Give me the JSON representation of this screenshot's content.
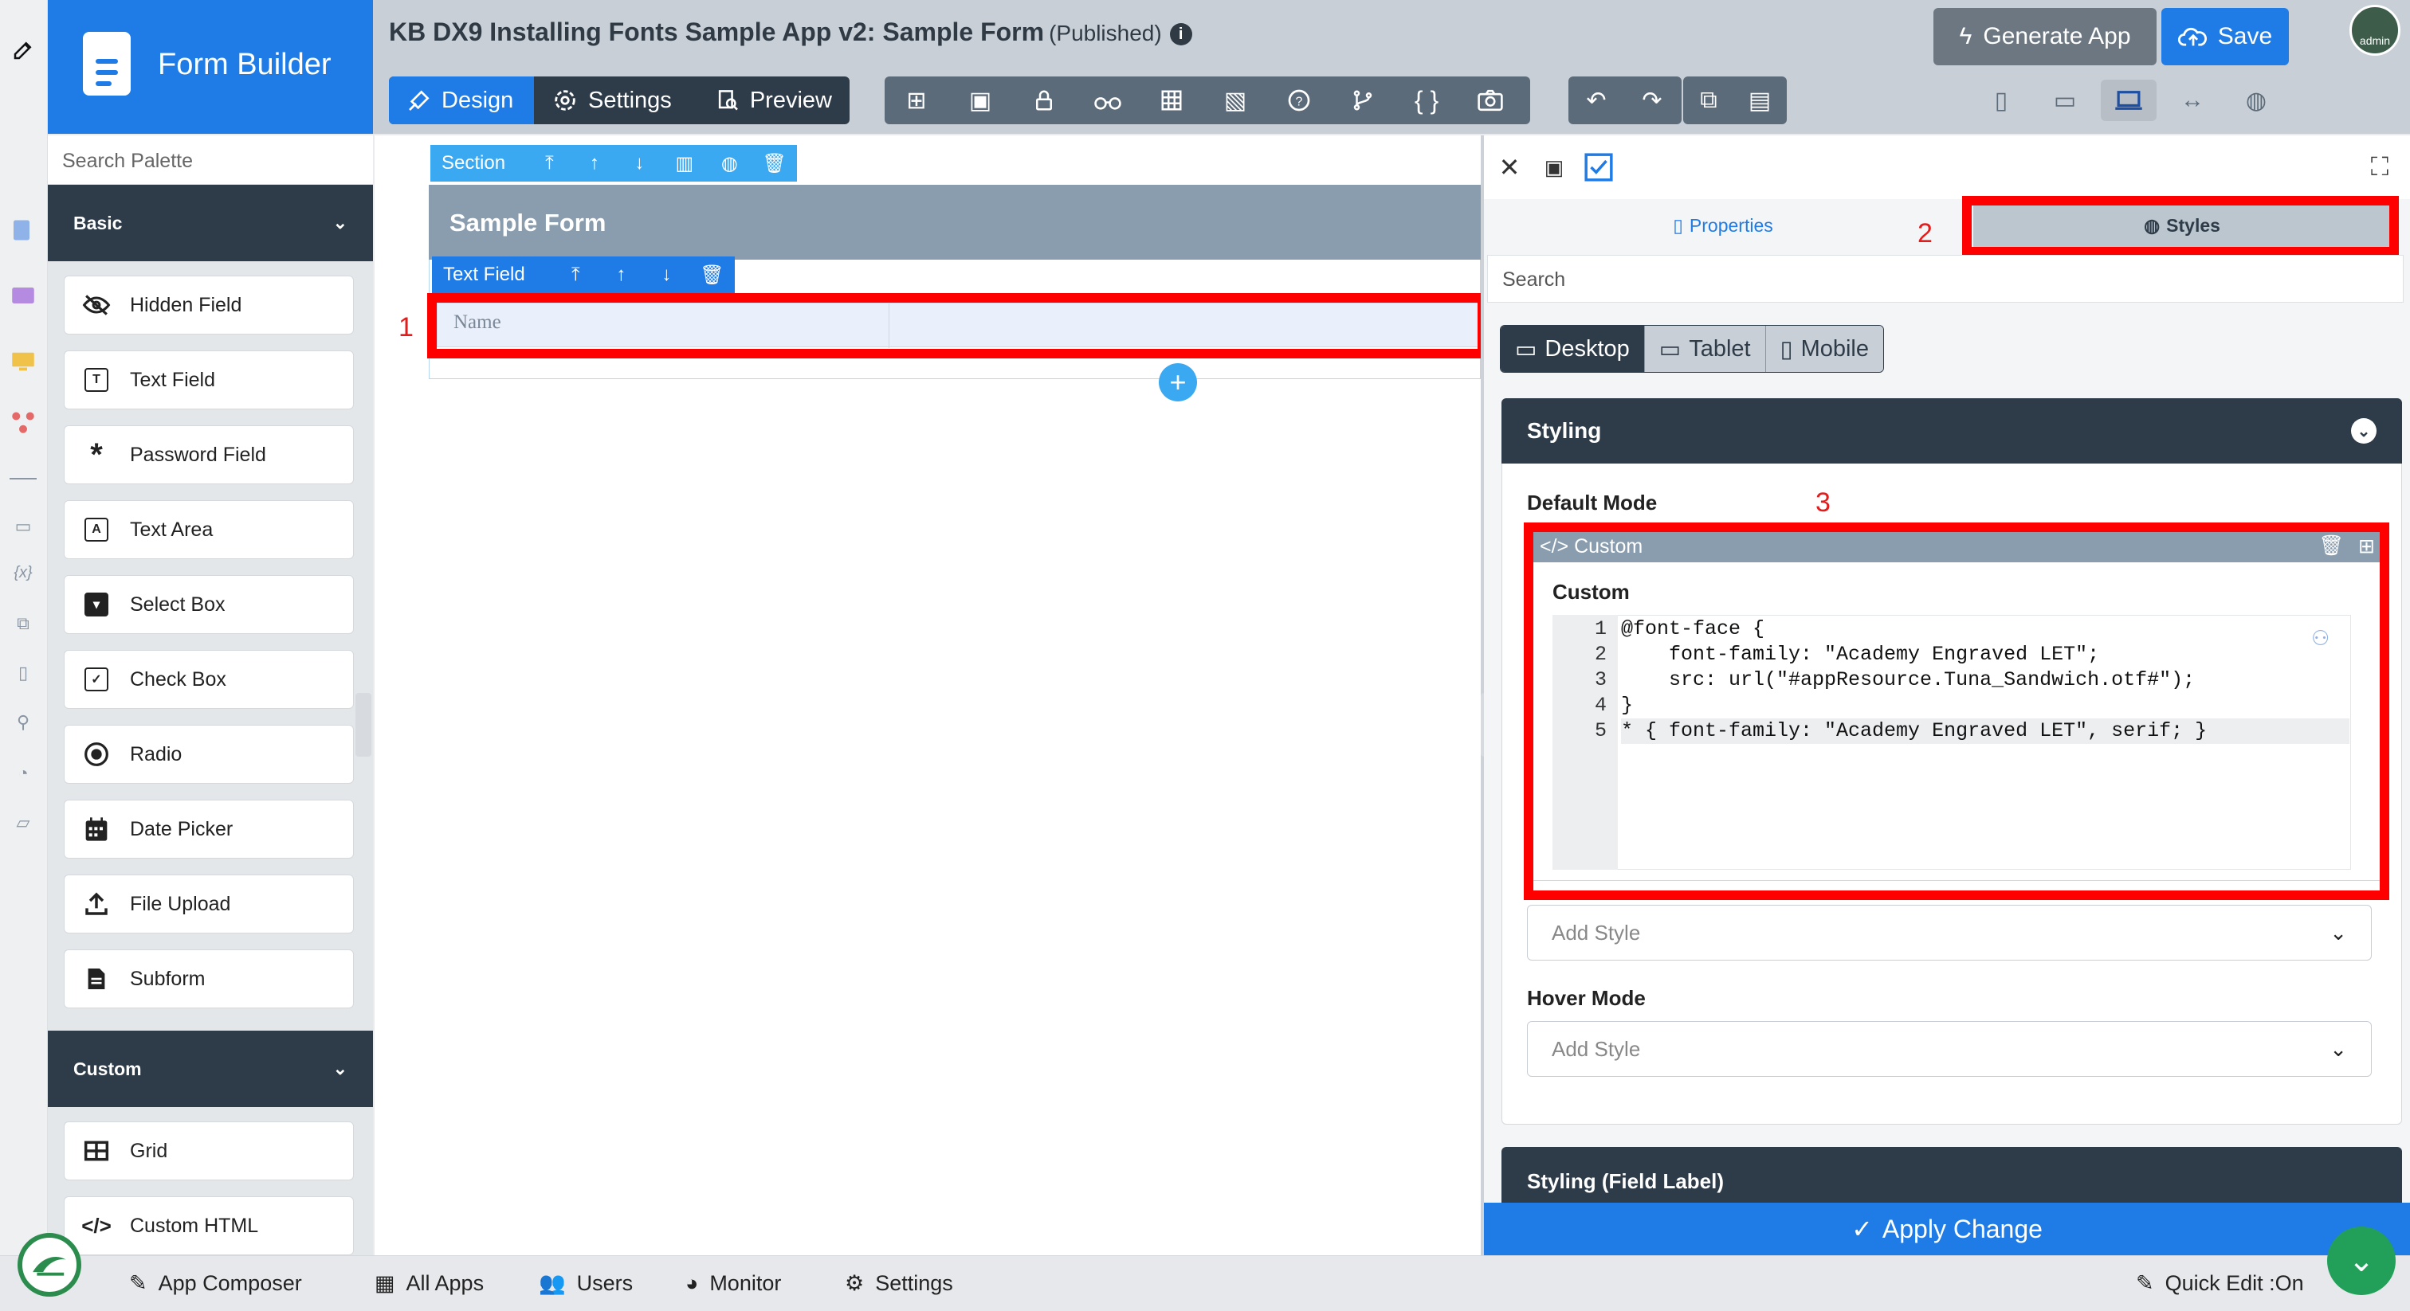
{
  "app": {
    "brand": "Form Builder",
    "title": "KB DX9 Installing Fonts Sample App v2: Sample Form",
    "status": "(Published)"
  },
  "tabs": [
    {
      "label": "Design",
      "icon": "design-icon",
      "active": true
    },
    {
      "label": "Settings",
      "icon": "gear-icon",
      "active": false
    },
    {
      "label": "Preview",
      "icon": "preview-icon",
      "active": false
    }
  ],
  "toolbar_icons": [
    "tree-icon",
    "table-export-icon",
    "lock-icon",
    "binoculars-icon",
    "grid-icon",
    "image-edit-icon",
    "help-icon",
    "branch-icon",
    "braces-icon",
    "camera-icon"
  ],
  "header_buttons": {
    "generate": "Generate App",
    "save": "Save",
    "avatar": "admin"
  },
  "palette": {
    "search_placeholder": "Search Palette",
    "basic_header": "Basic",
    "basic_items": [
      {
        "label": "Hidden Field",
        "icon": "eye-slash-icon"
      },
      {
        "label": "Text Field",
        "icon": "text-field-icon"
      },
      {
        "label": "Password Field",
        "icon": "asterisk-icon"
      },
      {
        "label": "Text Area",
        "icon": "text-area-icon"
      },
      {
        "label": "Select Box",
        "icon": "select-box-icon"
      },
      {
        "label": "Check Box",
        "icon": "check-box-icon"
      },
      {
        "label": "Radio",
        "icon": "radio-icon"
      },
      {
        "label": "Date Picker",
        "icon": "calendar-icon"
      },
      {
        "label": "File Upload",
        "icon": "upload-icon"
      },
      {
        "label": "Subform",
        "icon": "subform-icon"
      }
    ],
    "custom_header": "Custom",
    "custom_items": [
      {
        "label": "Grid",
        "icon": "grid-icon"
      },
      {
        "label": "Custom HTML",
        "icon": "code-icon"
      }
    ]
  },
  "canvas": {
    "section_label": "Section",
    "form_title": "Sample Form",
    "textfield_label": "Text Field",
    "field_placeholder": "Name"
  },
  "annotations": [
    "1",
    "2",
    "3"
  ],
  "right_panel": {
    "tab_properties": "Properties",
    "tab_styles": "Styles",
    "search_placeholder": "Search",
    "devices": [
      "Desktop",
      "Tablet",
      "Mobile"
    ],
    "styling_header": "Styling",
    "default_mode": "Default Mode",
    "custom_header": "Custom",
    "custom_label": "Custom",
    "code_lines": [
      "@font-face {",
      "    font-family: \"Academy Engraved LET\";",
      "    src: url(\"#appResource.Tuna_Sandwich.otf#\");",
      "}",
      "* { font-family: \"Academy Engraved LET\", serif; }"
    ],
    "line_numbers": [
      "1",
      "2",
      "3",
      "4",
      "5"
    ],
    "add_style": "Add Style",
    "hover_mode": "Hover Mode",
    "styling_field_label": "Styling (Field Label)",
    "apply": "Apply Change"
  },
  "bottom_bar": {
    "items": [
      "App Composer",
      "All Apps",
      "Users",
      "Monitor",
      "Settings"
    ],
    "quick_edit": "Quick Edit :On"
  }
}
